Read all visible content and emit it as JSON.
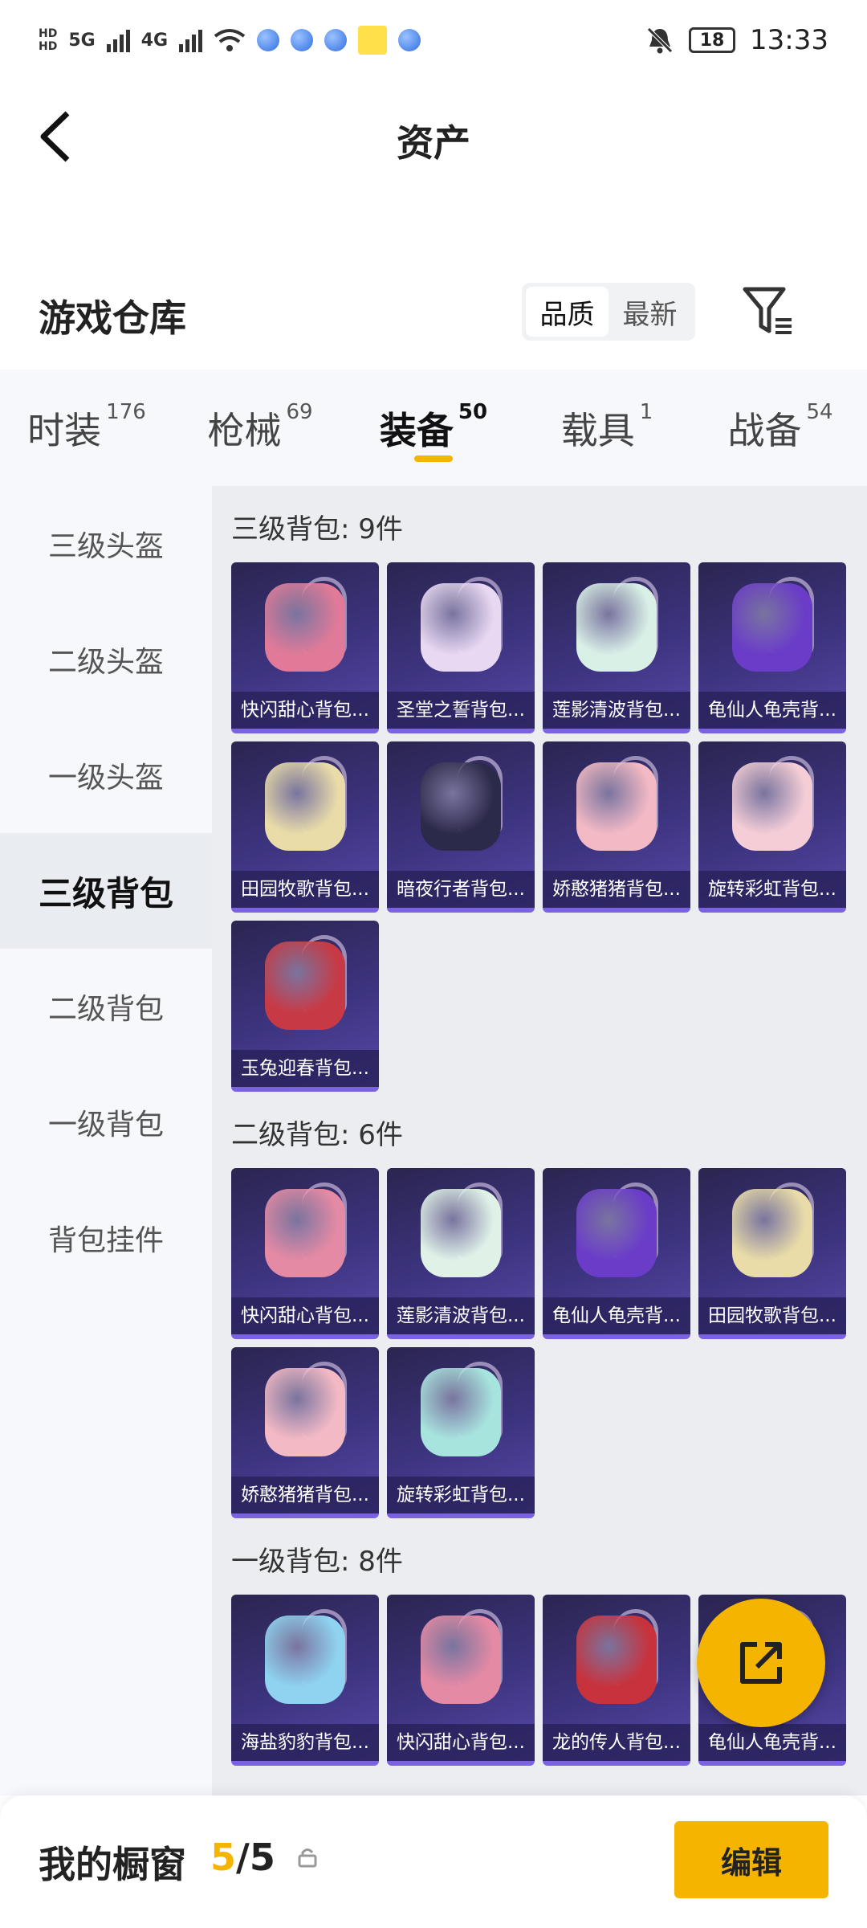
{
  "status_bar": {
    "hd1": "HD",
    "hd2": "HD",
    "sig1": "5G",
    "sig2": "4G",
    "battery": "18",
    "time": "13:33"
  },
  "header": {
    "title": "资产"
  },
  "warehouse": {
    "title": "游戏仓库",
    "sort_options": [
      "品质",
      "最新"
    ],
    "selected_sort": "品质"
  },
  "tabs": [
    {
      "label": "时装",
      "count": "176"
    },
    {
      "label": "枪械",
      "count": "69"
    },
    {
      "label": "装备",
      "count": "50"
    },
    {
      "label": "载具",
      "count": "1"
    },
    {
      "label": "战备",
      "count": "54"
    }
  ],
  "active_tab": "装备",
  "sidebar": {
    "items": [
      "三级头盔",
      "二级头盔",
      "一级头盔",
      "三级背包",
      "二级背包",
      "一级背包",
      "背包挂件"
    ],
    "active": "三级背包"
  },
  "sections": [
    {
      "title": "三级背包: 9件",
      "items": [
        {
          "name": "快闪甜心背包...",
          "color": "#e07a98"
        },
        {
          "name": "圣堂之誓背包...",
          "color": "#e8d8f2"
        },
        {
          "name": "莲影清波背包...",
          "color": "#d9f0e6"
        },
        {
          "name": "龟仙人龟壳背...",
          "color": "#6a3cc8"
        },
        {
          "name": "田园牧歌背包...",
          "color": "#e9dca8"
        },
        {
          "name": "暗夜行者背包...",
          "color": "#2c2a4a"
        },
        {
          "name": "娇憨猪猪背包...",
          "color": "#f3b9c4"
        },
        {
          "name": "旋转彩虹背包...",
          "color": "#f4cdd6"
        },
        {
          "name": "玉兔迎春背包...",
          "color": "#c73a45"
        }
      ]
    },
    {
      "title": "二级背包: 6件",
      "items": [
        {
          "name": "快闪甜心背包...",
          "color": "#e58aa4"
        },
        {
          "name": "莲影清波背包...",
          "color": "#e0f2e8"
        },
        {
          "name": "龟仙人龟壳背...",
          "color": "#6a3cc8"
        },
        {
          "name": "田园牧歌背包...",
          "color": "#e9dca8"
        },
        {
          "name": "娇憨猪猪背包...",
          "color": "#f3b9c4"
        },
        {
          "name": "旋转彩虹背包...",
          "color": "#a8e4de"
        }
      ]
    },
    {
      "title": "一级背包: 8件",
      "items": [
        {
          "name": "海盐豹豹背包...",
          "color": "#8fd3f0"
        },
        {
          "name": "快闪甜心背包...",
          "color": "#e58aa4"
        },
        {
          "name": "龙的传人背包...",
          "color": "#c8323c"
        },
        {
          "name": "龟仙人龟壳背...",
          "color": "#6a3cc8"
        }
      ]
    }
  ],
  "fab": {
    "icon": "share-icon"
  },
  "bottom_bar": {
    "label": "我的橱窗",
    "current": "5",
    "separator": "/",
    "total": "5",
    "edit_label": "编辑"
  },
  "colors": {
    "accent": "#f5b400",
    "card_bg": "#3d3480"
  }
}
